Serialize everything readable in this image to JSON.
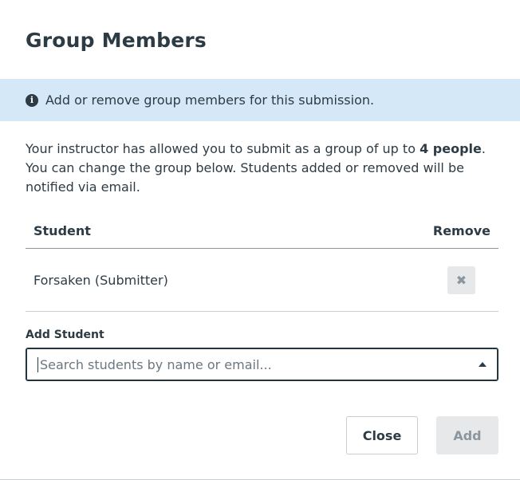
{
  "dialog": {
    "title": "Group Members",
    "alert": {
      "icon": "info-icon",
      "text": "Add or remove group members for this submission."
    },
    "description": {
      "part1": "Your instructor has allowed you to submit as a group of up to ",
      "limit": "4",
      "bold_suffix": " people",
      "part2": ". You can change the group below. Students added or removed will be notified via email."
    },
    "table": {
      "headers": {
        "student": "Student",
        "remove": "Remove"
      },
      "rows": [
        {
          "name": "Forsaken (Submitter)",
          "remove_icon": "close-icon"
        }
      ]
    },
    "add_student": {
      "label": "Add Student",
      "placeholder": "Search students by name or email...",
      "value": ""
    },
    "buttons": {
      "close": "Close",
      "add": "Add"
    }
  }
}
